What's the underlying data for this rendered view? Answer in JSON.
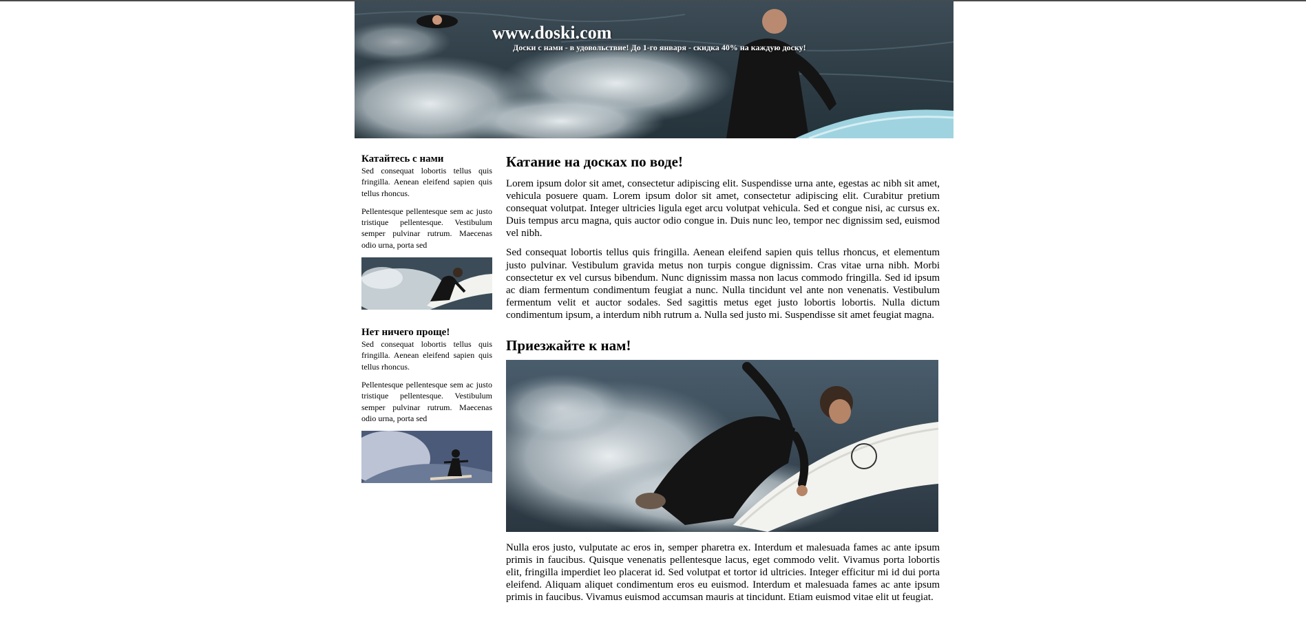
{
  "header": {
    "site_title": "www.doski.com",
    "slogan": "Доски с нами - в удовольствие! До 1-го января - скидка 40% на каждую доску!"
  },
  "sidebar": {
    "blocks": [
      {
        "heading": "Катайтесь с нами",
        "paragraphs": [
          "Sed consequat lobortis tellus quis fringilla. Aenean eleifend sapien quis tellus rhoncus.",
          "Pellentesque pellentesque sem ac justo tristique pellentesque. Vestibulum semper pulvinar rutrum. Maecenas odio urna, porta sed"
        ]
      },
      {
        "heading": "Нет ничего проще!",
        "paragraphs": [
          "Sed consequat lobortis tellus quis fringilla. Aenean eleifend sapien quis tellus rhoncus.",
          "Pellentesque pellentesque sem ac justo tristique pellentesque. Vestibulum semper pulvinar rutrum. Maecenas odio urna, porta sed"
        ]
      }
    ]
  },
  "main": {
    "heading1": "Катание на досках по воде!",
    "paragraph1": "Lorem ipsum dolor sit amet, consectetur adipiscing elit. Suspendisse urna ante, egestas ac nibh sit amet, vehicula posuere quam. Lorem ipsum dolor sit amet, consectetur adipiscing elit. Curabitur pretium consequat volutpat. Integer ultricies ligula eget arcu volutpat vehicula. Sed et congue nisi, ac cursus ex. Duis tempus arcu magna, quis auctor odio congue in. Duis nunc leo, tempor nec dignissim sed, euismod vel nibh.",
    "paragraph2": "Sed consequat lobortis tellus quis fringilla. Aenean eleifend sapien quis tellus rhoncus, et elementum justo pulvinar. Vestibulum gravida metus non turpis congue dignissim. Cras vitae urna nibh. Morbi consectetur ex vel cursus bibendum. Nunc dignissim massa non lacus commodo fringilla. Sed id ipsum ac diam fermentum condimentum feugiat a nunc. Nulla tincidunt vel ante non venenatis. Vestibulum fermentum velit et auctor sodales. Sed sagittis metus eget justo lobortis lobortis. Nulla dictum condimentum ipsum, a interdum nibh rutrum a. Nulla sed justo mi. Suspendisse sit amet feugiat magna.",
    "heading2": "Приезжайте к нам!",
    "paragraph3": "Nulla eros justo, vulputate ac eros in, semper pharetra ex. Interdum et malesuada fames ac ante ipsum primis in faucibus. Quisque venenatis pellentesque lacus, eget commodo velit. Vivamus porta lobortis elit, fringilla imperdiet leo placerat id. Sed volutpat et tortor id ultricies. Integer efficitur mi id dui porta eleifend. Aliquam aliquet condimentum eros eu euismod. Interdum et malesuada fames ac ante ipsum primis in faucibus. Vivamus euismod accumsan mauris at tincidunt. Etiam euismod vitae elit ut feugiat."
  },
  "colors": {
    "water_dark": "#2c3a44",
    "water_mid": "#4d5f6b",
    "spray": "#e6ecef",
    "wetsuit": "#141414",
    "board_blue": "#9fd3e0",
    "board_white": "#f2f2ee"
  }
}
